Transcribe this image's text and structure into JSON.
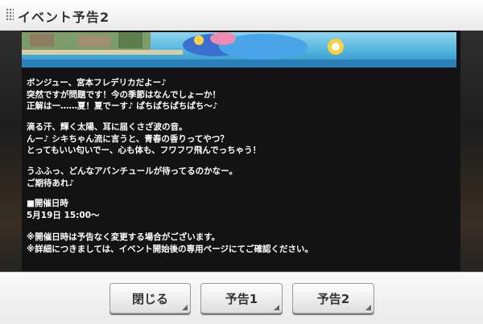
{
  "dialog": {
    "title": "イベント予告2"
  },
  "message": {
    "paragraphs": [
      [
        "ボンジュー、宮本フレデリカだよー♪",
        "突然ですが問題です！今の季節はなんでしょーか！",
        "正解は一……夏！夏でーす♪ ぱちぱちぱちぱち〜♪"
      ],
      [
        "滴る汗、輝く太陽、耳に届くさざ波の音。",
        "んー♪ シキちゃん流に言うと、青春の香りってやつ？",
        "とってもいい匂いでー、心も体も、フワフワ飛んでっちゃう！"
      ],
      [
        "うふふっ、どんなアバンチュールが待ってるのかなー。",
        "ご期待あれ♪"
      ],
      [
        "■開催日時",
        "5月19日 15:00〜"
      ],
      [
        "※開催日時は予告なく変更する場合がございます。",
        "※詳細につきましては、イベント開始後の専用ページにてご確認ください。"
      ]
    ]
  },
  "buttons": {
    "close": "閉じる",
    "preview1": "予告1",
    "preview2": "予告2"
  }
}
